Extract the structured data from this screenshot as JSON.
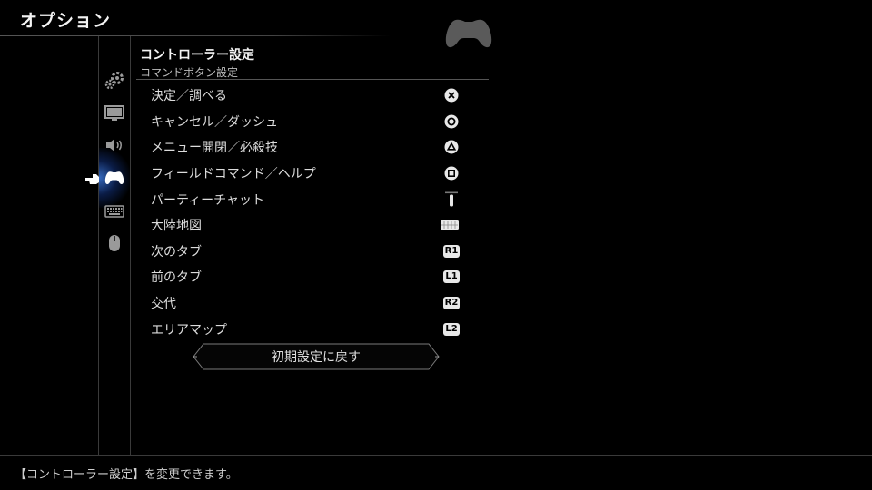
{
  "header": {
    "title": "オプション"
  },
  "section": {
    "title": "コントローラー設定",
    "subtitle": "コマンドボタン設定"
  },
  "categories": [
    {
      "name": "gear",
      "active": false
    },
    {
      "name": "monitor",
      "active": false
    },
    {
      "name": "speaker",
      "active": false
    },
    {
      "name": "gamepad",
      "active": true
    },
    {
      "name": "keyboard",
      "active": false
    },
    {
      "name": "mouse",
      "active": false
    }
  ],
  "bindings": [
    {
      "label": "決定／調べる",
      "button": "cross"
    },
    {
      "label": "キャンセル／ダッシュ",
      "button": "circle"
    },
    {
      "label": "メニュー開閉／必殺技",
      "button": "triangle"
    },
    {
      "label": "フィールドコマンド／ヘルプ",
      "button": "square"
    },
    {
      "label": "パーティーチャット",
      "button": "options"
    },
    {
      "label": "大陸地図",
      "button": "touchpad"
    },
    {
      "label": "次のタブ",
      "button": "R1"
    },
    {
      "label": "前のタブ",
      "button": "L1"
    },
    {
      "label": "交代",
      "button": "R2"
    },
    {
      "label": "エリアマップ",
      "button": "L2"
    }
  ],
  "reset_button": {
    "label": "初期設定に戻す"
  },
  "footer": {
    "hint": "【コントローラー設定】を変更できます。"
  },
  "colors": {
    "background": "#000000",
    "accent_glow": "#4a8cff",
    "text": "#e6e6e6"
  }
}
